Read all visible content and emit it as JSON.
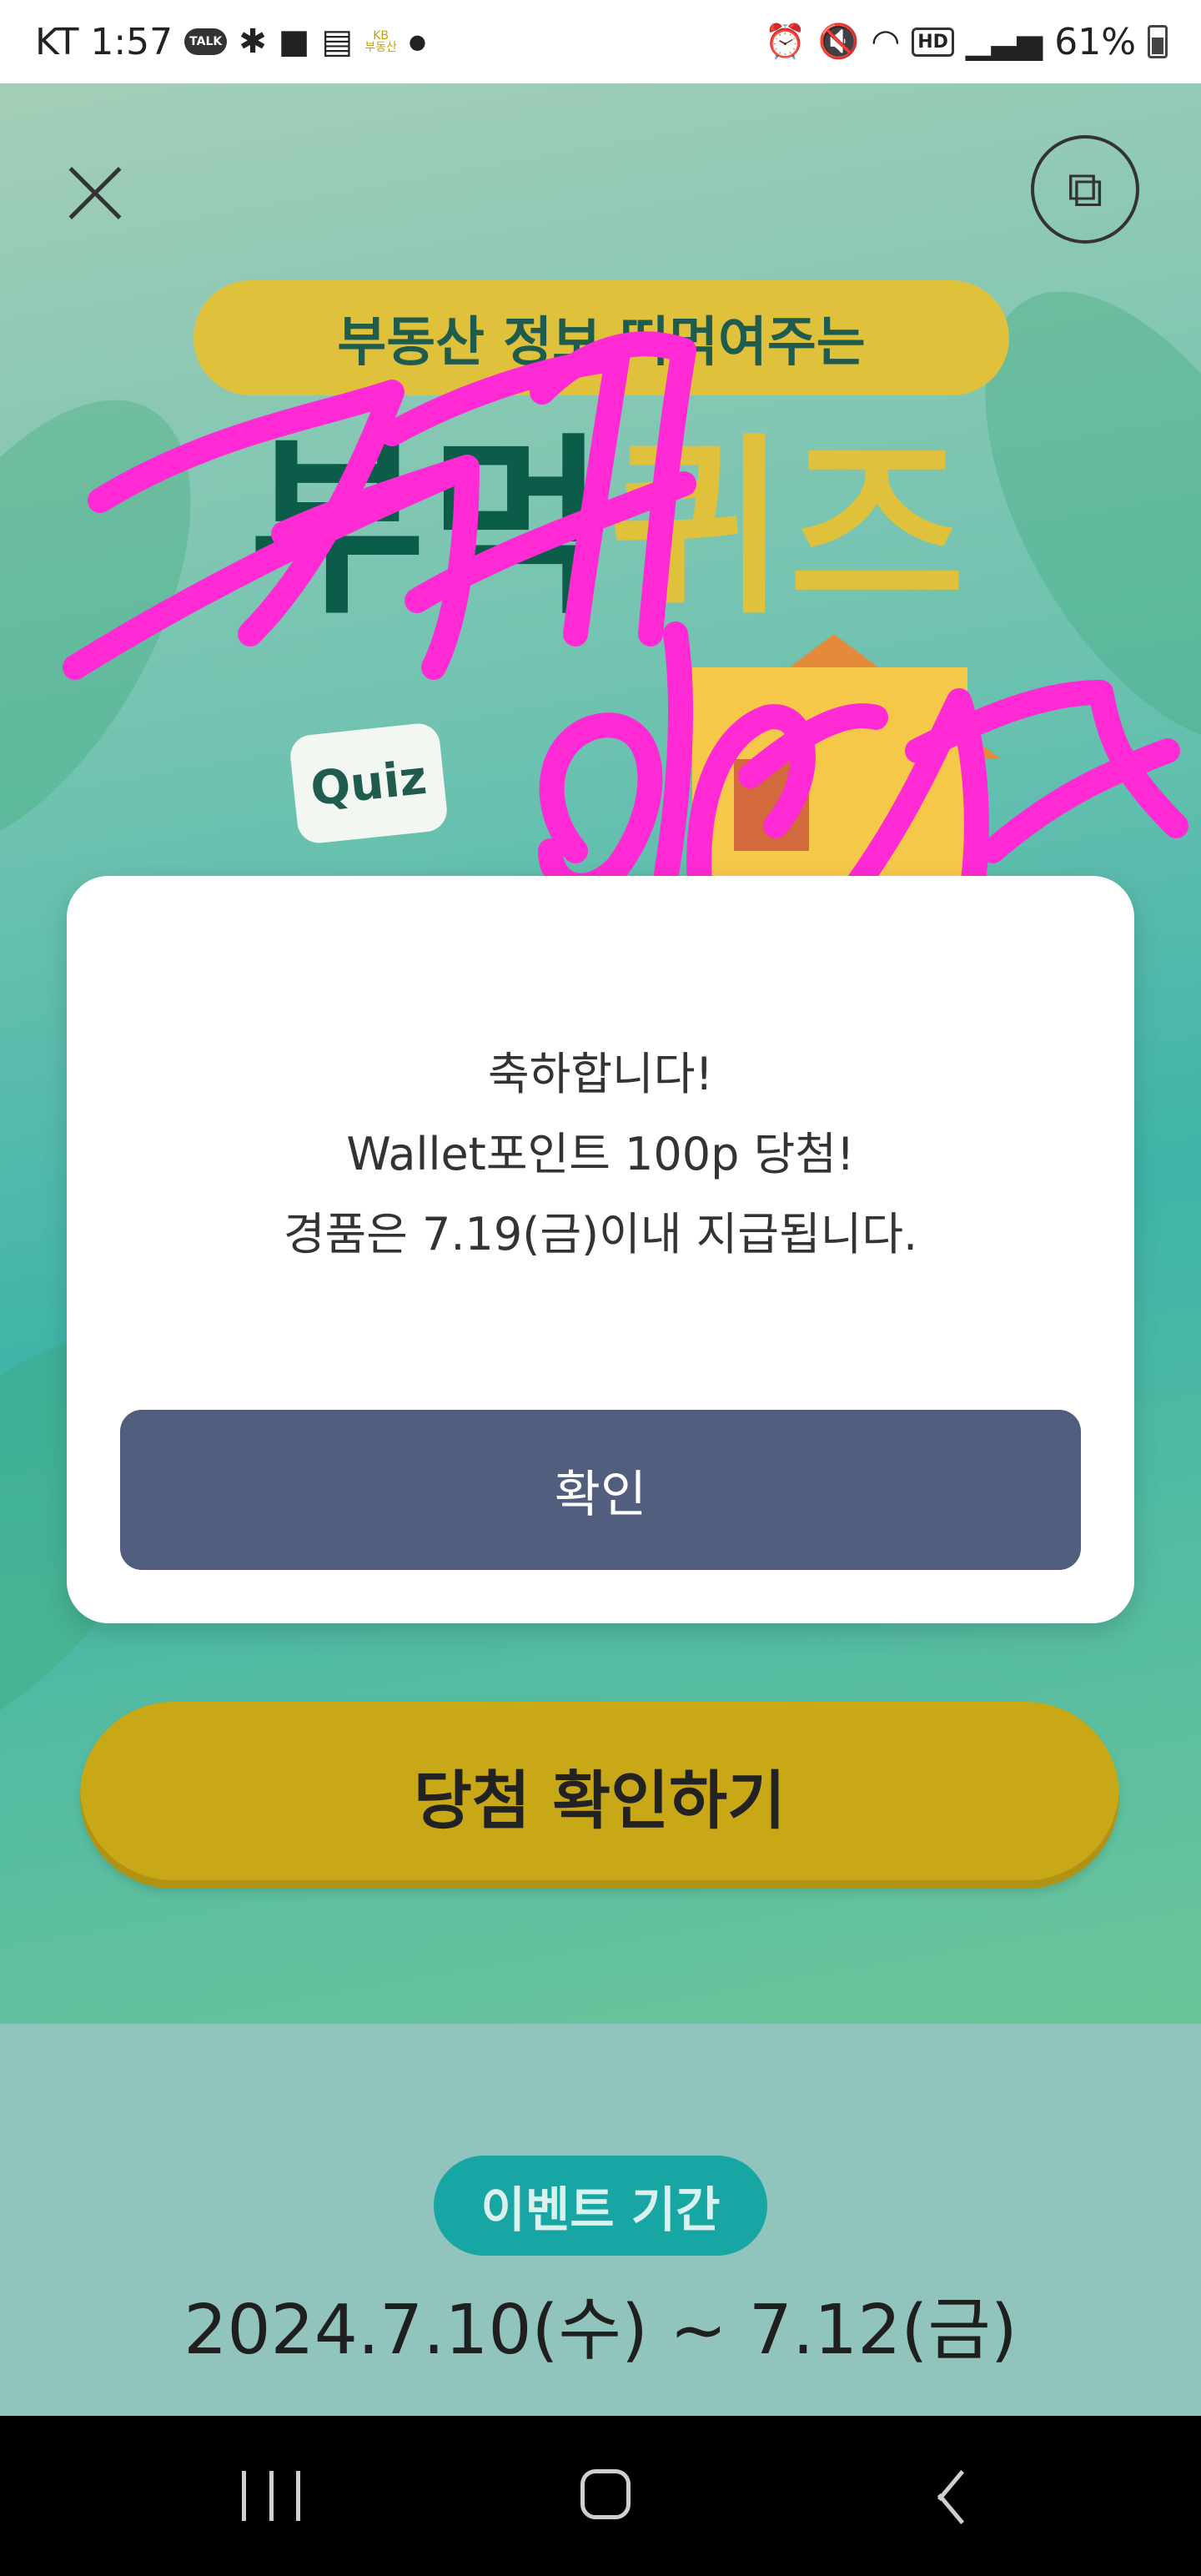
{
  "status_bar": {
    "carrier": "KT",
    "time": "1:57",
    "talk_badge": "TALK",
    "kb_badge_top": "KB",
    "kb_badge_bottom": "부동산",
    "hd_badge": "HD",
    "battery_percent": "61%",
    "icons": [
      "kakaotalk-icon",
      "slack-icon",
      "note-icon",
      "feed-icon",
      "kb-realestate-icon",
      "dot-icon",
      "alarm-icon",
      "mute-icon",
      "wifi-icon",
      "hd-icon",
      "signal-icon",
      "battery-icon"
    ]
  },
  "header": {
    "close_icon": "close-icon",
    "share_icon": "share-icon"
  },
  "hero": {
    "banner_subtitle": "부동산 정보 떠먹여주는",
    "banner_title_part1": "부먹",
    "banner_title_part2": "퀴즈",
    "quiz_bubble": "Quiz"
  },
  "modal": {
    "line1": "축하합니다!",
    "line2": "Wallet포인트 100p 당첨!",
    "line3": "경품은 7.19(금)이내 지급됩니다.",
    "confirm_label": "확인"
  },
  "check_button": {
    "label": "당첨 확인하기"
  },
  "event_period": {
    "badge": "이벤트 기간",
    "dates": "2024.7.10(수) ~ 7.12(금)"
  },
  "nav_bar": {
    "icons": [
      "recent-apps-icon",
      "home-icon",
      "back-icon"
    ]
  },
  "colors": {
    "modal_button": "#525e7d",
    "check_button": "#c9a817",
    "period_badge": "#17a6a3",
    "scribble": "#ff2ad4"
  }
}
